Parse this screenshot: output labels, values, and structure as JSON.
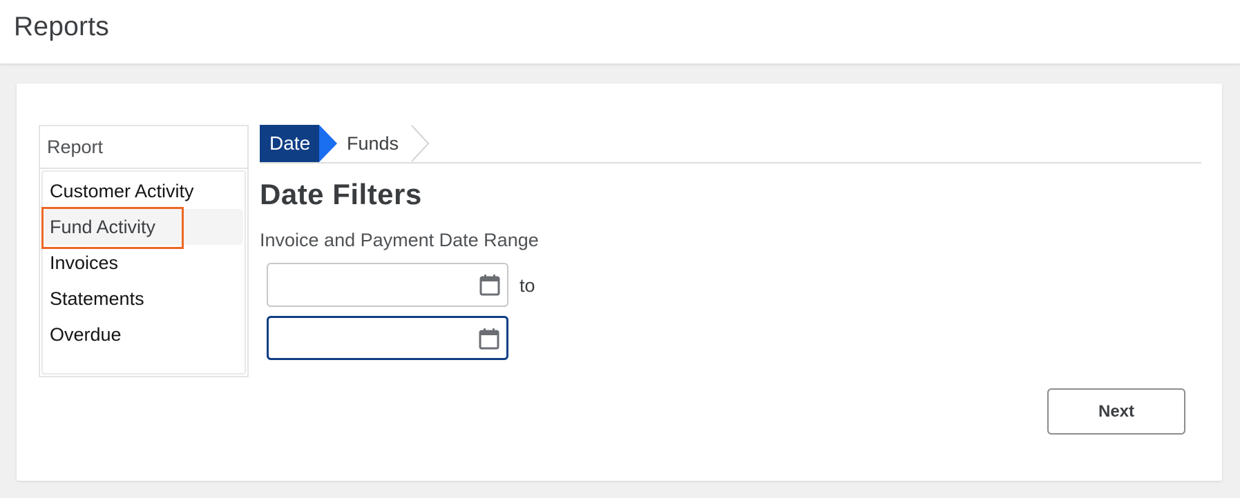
{
  "header": {
    "title": "Reports"
  },
  "report_menu": {
    "header_label": "Report",
    "items": [
      {
        "label": "Customer Activity",
        "selected": false
      },
      {
        "label": "Fund Activity",
        "selected": true,
        "highlighted": true
      },
      {
        "label": "Invoices",
        "selected": false
      },
      {
        "label": "Statements",
        "selected": false
      },
      {
        "label": "Overdue",
        "selected": false
      }
    ]
  },
  "wizard": {
    "steps": [
      {
        "label": "Date",
        "active": true
      },
      {
        "label": "Funds",
        "active": false
      }
    ]
  },
  "date_filters": {
    "title": "Date Filters",
    "range_label": "Invoice and Payment Date Range",
    "start_value": "",
    "end_value": "",
    "separator": "to",
    "start_icon": "calendar-icon",
    "end_icon": "calendar-icon"
  },
  "actions": {
    "next_label": "Next"
  },
  "colors": {
    "active_step": "#0f3e85",
    "step_arrow": "#1a6ef0",
    "highlight": "#ec6726",
    "focus_border": "#0f3e85"
  }
}
